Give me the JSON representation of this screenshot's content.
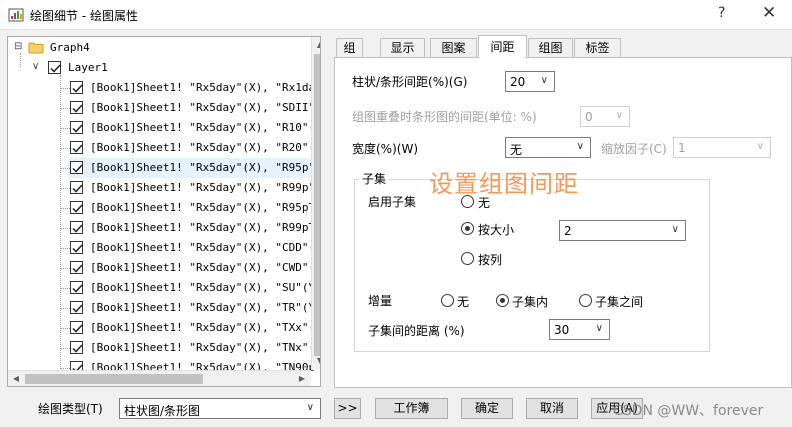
{
  "window": {
    "title": "绘图细节 - 绘图属性",
    "help": "?",
    "close": "✕"
  },
  "tree": {
    "graph": "Graph4",
    "layer": "Layer1",
    "items": [
      "[Book1]Sheet1! \"Rx5day\"(X), \"Rx1day\"",
      "[Book1]Sheet1! \"Rx5day\"(X), \"SDII\"(Y",
      "[Book1]Sheet1! \"Rx5day\"(X), \"R10\"(Y)",
      "[Book1]Sheet1! \"Rx5day\"(X), \"R20\"(Y)",
      "[Book1]Sheet1! \"Rx5day\"(X), \"R95p\"(Y",
      "[Book1]Sheet1! \"Rx5day\"(X), \"R99p\"(Y",
      "[Book1]Sheet1! \"Rx5day\"(X), \"R95pTOT",
      "[Book1]Sheet1! \"Rx5day\"(X), \"R99pTOT",
      "[Book1]Sheet1! \"Rx5day\"(X), \"CDD\"(Y)",
      "[Book1]Sheet1! \"Rx5day\"(X), \"CWD\"(Y)",
      "[Book1]Sheet1! \"Rx5day\"(X), \"SU\"(Y)",
      "[Book1]Sheet1! \"Rx5day\"(X), \"TR\"(Y)",
      "[Book1]Sheet1! \"Rx5day\"(X), \"TXx\"(Y)",
      "[Book1]Sheet1! \"Rx5day\"(X), \"TNx\"(Y)",
      "[Book1]Sheet1! \"Rx5day\"(X), \"TN90p\"("
    ],
    "selected_index": 4
  },
  "tabs": [
    "组",
    "显示",
    "图案",
    "间距",
    "组图",
    "标签"
  ],
  "active_tab": "间距",
  "spacing": {
    "gap_label": "柱状/条形间距(%)(G)",
    "gap_value": "20",
    "overlap_label": "组图重叠时条形图的间距(单位: %)",
    "overlap_value": "0",
    "width_label": "宽度(%)(W)",
    "width_value": "无",
    "scale_label": "缩放因子(C)",
    "scale_value": "1"
  },
  "subset": {
    "group_title": "子集",
    "enable_label": "启用子集",
    "opt_none": "无",
    "opt_size": "按大小",
    "size_value": "2",
    "opt_column": "按列",
    "increment_label": "增量",
    "inc_none": "无",
    "inc_within": "子集内",
    "inc_between": "子集之间",
    "distance_label": "子集间的距离 (%)",
    "distance_value": "30"
  },
  "overlay": "设置组图间距",
  "bottom": {
    "plot_type_label": "绘图类型(T)",
    "plot_type_value": "柱状图/条形图",
    "expand": ">>",
    "workbook": "工作簿",
    "ok": "确定",
    "cancel": "取消",
    "apply": "应用(A)"
  },
  "watermark": "CSDN @WW、forever",
  "colors": {
    "selected_row": "#e5f1fb",
    "overlay_text": "#f39a5a"
  }
}
